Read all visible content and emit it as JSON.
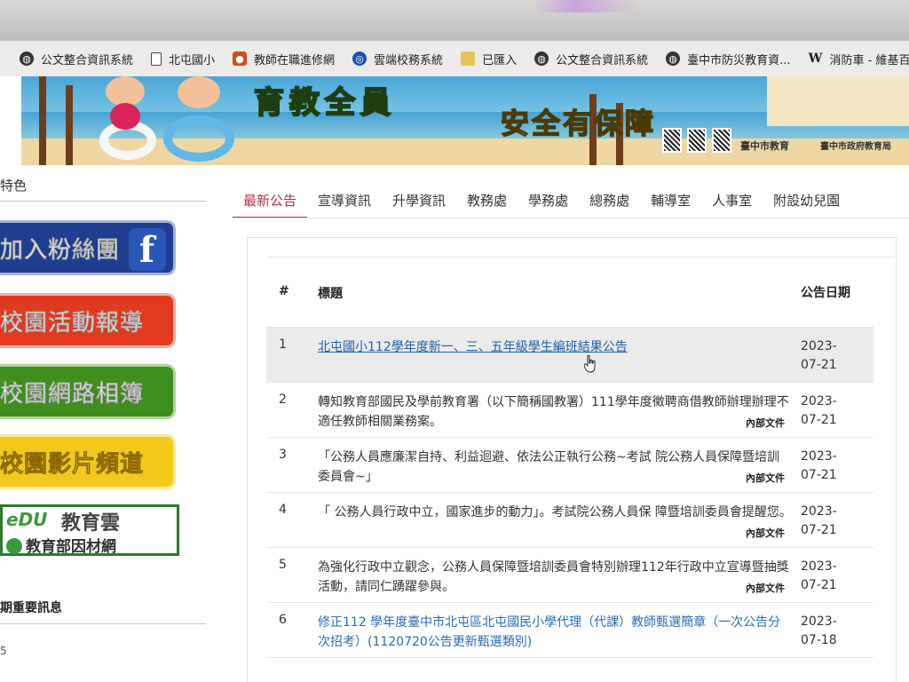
{
  "bookmarks": [
    {
      "label": "公文整合資訊系統",
      "icon": "globe-icon"
    },
    {
      "label": "北屯國小",
      "icon": "document-icon"
    },
    {
      "label": "教師在職進修網",
      "icon": "orange-app-icon"
    },
    {
      "label": "雲端校務系統",
      "icon": "blue-circle-icon"
    },
    {
      "label": "已匯入",
      "icon": "folder-icon"
    },
    {
      "label": "公文整合資訊系統",
      "icon": "globe-icon"
    },
    {
      "label": "臺中市防災教育資...",
      "icon": "globe-icon"
    },
    {
      "label": "消防車 - 維基百科",
      "icon": "wikipedia-icon"
    }
  ],
  "banner": {
    "title_green": "育教全員",
    "title_yellow": "安全有保障",
    "logo1": "臺中市教育",
    "logo2": "臺中市政府教育局"
  },
  "sidebar": {
    "section_title": "特色",
    "buttons": [
      {
        "label": "加入粉絲團"
      },
      {
        "label": "校園活動報導"
      },
      {
        "label": "校園網路相簿"
      },
      {
        "label": "校園影片頻道"
      }
    ],
    "edu_logo": "eDU",
    "edu_cloud": "教育雲",
    "edu_sub": "教育部因材網",
    "section_title2": "期重要訊息",
    "small_text": "5"
  },
  "tabs": [
    {
      "label": "最新公告",
      "active": true
    },
    {
      "label": "宣導資訊"
    },
    {
      "label": "升學資訊"
    },
    {
      "label": "教務處"
    },
    {
      "label": "學務處"
    },
    {
      "label": "總務處"
    },
    {
      "label": "輔導室"
    },
    {
      "label": "人事室"
    },
    {
      "label": "附設幼兒園"
    }
  ],
  "table": {
    "headers": {
      "num": "#",
      "title": "標題",
      "date": "公告日期"
    },
    "rows": [
      {
        "num": "1",
        "title": "北屯國小112學年度新一、三、五年級學生編班結果公告",
        "tag": "",
        "date_y": "2023-",
        "date_md": "07-21",
        "style": "link"
      },
      {
        "num": "2",
        "title": "轉知教育部國民及學前教育署（以下簡稱國教署）111學年度徵聘商借教師辦理辦理不適任教師相關業務案。",
        "tag": "內部文件",
        "date_y": "2023-",
        "date_md": "07-21",
        "style": "plain"
      },
      {
        "num": "3",
        "title": "「公務人員應廉潔自持、利益迴避、依法公正執行公務~考試 院公務人員保障暨培訓委員會~」",
        "tag": "內部文件",
        "date_y": "2023-",
        "date_md": "07-21",
        "style": "plain"
      },
      {
        "num": "4",
        "title": "「 公務人員行政中立，國家進步的動力」。考試院公務人員保 障暨培訓委員會提醒您。",
        "tag": "內部文件",
        "date_y": "2023-",
        "date_md": "07-21",
        "style": "plain"
      },
      {
        "num": "5",
        "title": "為強化行政中立觀念，公務人員保障暨培訓委員會特別辦理112年行政中立宣導暨抽獎活動，請同仁踴躍參與。",
        "tag": "內部文件",
        "date_y": "2023-",
        "date_md": "07-21",
        "style": "plain"
      },
      {
        "num": "6",
        "title": "修正112 學年度臺中市北屯區北屯國民小學代理（代課）教師甄選簡章（一次公告分次招考）(1120720公告更新甄選類別)",
        "tag": "",
        "date_y": "2023-",
        "date_md": "07-18",
        "style": "blue"
      }
    ]
  }
}
